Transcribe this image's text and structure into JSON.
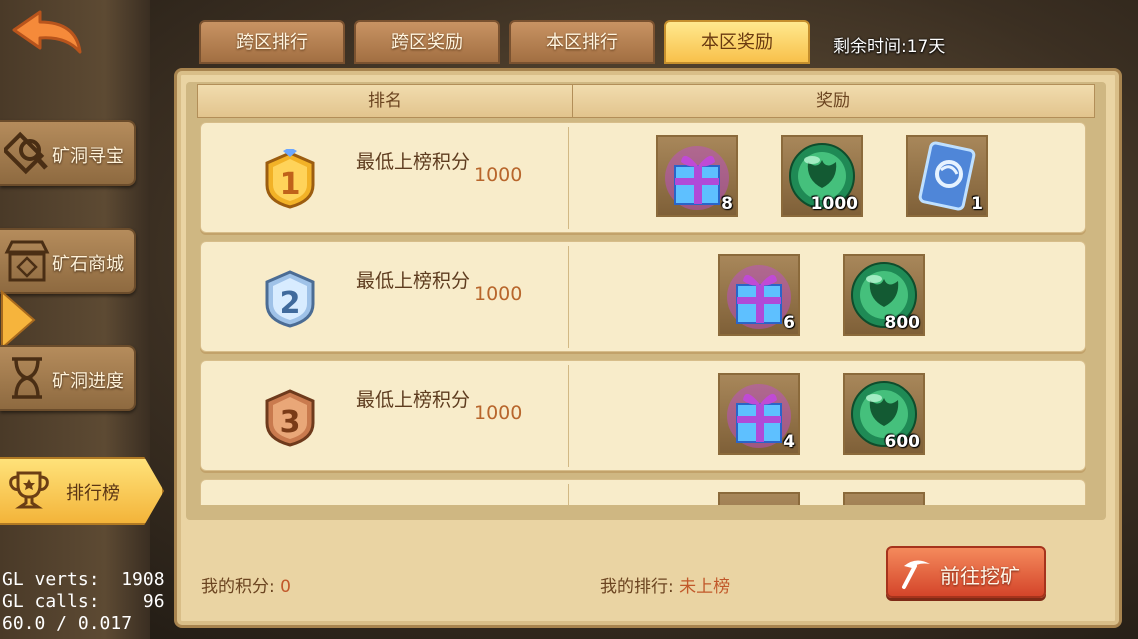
{
  "sidebar": {
    "items": [
      {
        "label": "矿洞寻宝"
      },
      {
        "label": "矿石商城"
      },
      {
        "label": "矿洞进度"
      },
      {
        "label": "排行榜"
      }
    ]
  },
  "tabs": [
    {
      "label": "跨区排行"
    },
    {
      "label": "跨区奖励"
    },
    {
      "label": "本区排行"
    },
    {
      "label": "本区奖励"
    }
  ],
  "timer": "剩余时间:17天",
  "table": {
    "headers": {
      "rank": "排名",
      "reward": "奖励"
    },
    "rows": [
      {
        "rank": "1",
        "label": "最低上榜积分",
        "score": "1000",
        "items": [
          {
            "type": "gift-box",
            "count": "8"
          },
          {
            "type": "green-orb",
            "count": "1000"
          },
          {
            "type": "blue-card",
            "count": "1"
          }
        ]
      },
      {
        "rank": "2",
        "label": "最低上榜积分",
        "score": "1000",
        "items": [
          {
            "type": "gift-box",
            "count": "6"
          },
          {
            "type": "green-orb",
            "count": "800"
          }
        ]
      },
      {
        "rank": "3",
        "label": "最低上榜积分",
        "score": "1000",
        "items": [
          {
            "type": "gift-box",
            "count": "4"
          },
          {
            "type": "green-orb",
            "count": "600"
          }
        ]
      }
    ]
  },
  "footer": {
    "my_score_label": "我的积分:",
    "my_score_value": "0",
    "my_rank_label": "我的排行:",
    "my_rank_value": "未上榜",
    "go_button": "前往挖矿"
  },
  "debug": {
    "line1": "GL verts:  1908",
    "line2": "GL calls:    96",
    "line3": "60.0 / 0.017"
  },
  "colors": {
    "accent": "#f8c14b",
    "panel": "#ead4a3",
    "button": "#d4452a"
  }
}
